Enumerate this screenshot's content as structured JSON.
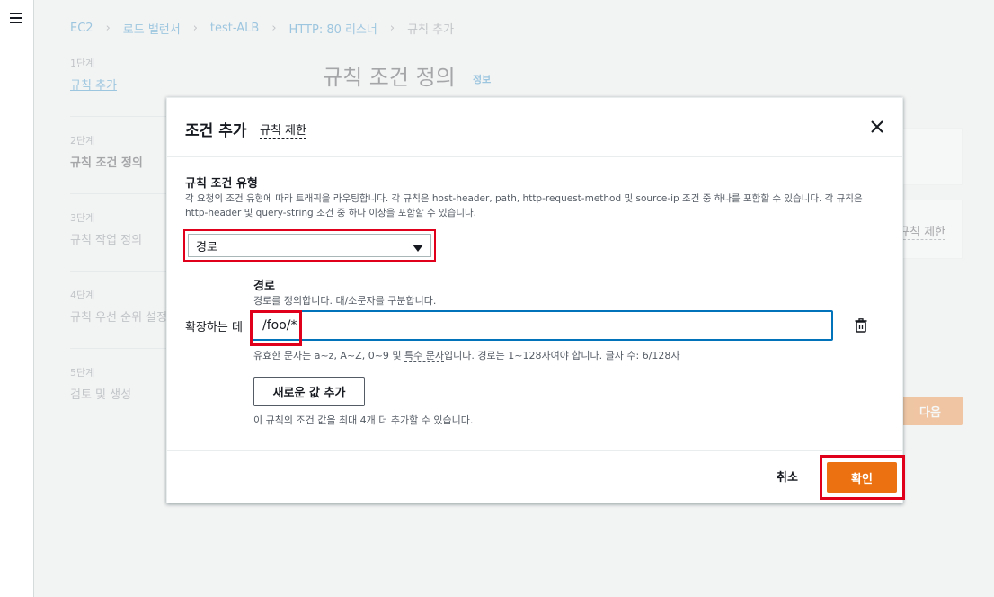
{
  "background": {
    "breadcrumb": [
      "EC2",
      "로드 밸런서",
      "test-ALB",
      "HTTP: 80 리스너",
      "규칙 추가"
    ],
    "steps": [
      {
        "num": "1단계",
        "label": "규칙 추가"
      },
      {
        "num": "2단계",
        "label": "규칙 조건 정의"
      },
      {
        "num": "3단계",
        "label": "규칙 작업 정의"
      },
      {
        "num": "4단계",
        "label": "규칙 우선 순위 설정"
      },
      {
        "num": "5단계",
        "label": "검토 및 생성"
      }
    ],
    "page_title": "규칙 조건 정의",
    "info_link": "정보",
    "rule_limit": "규칙 제한",
    "next_button": "다음"
  },
  "modal": {
    "title": "조건 추가",
    "subtitle_link": "규칙 제한",
    "field_label": "규칙 조건 유형",
    "field_desc": "각 요청의 조건 유형에 따라 트래픽을 라우팅합니다. 각 규칙은 host-header, path, http-request-method 및 source-ip 조건 중 하나를 포함할 수 있습니다. 각 규칙은 http-header 및 query-string 조건 중 하나 이상을 포함할 수 있습니다.",
    "select_value": "경로",
    "path_label": "경로",
    "path_desc": "경로를 정의합니다. 대/소문자를 구분합니다.",
    "row_label": "확장하는 데",
    "path_value": "/foo/*",
    "hint_prefix": "유효한 문자는 a~z, A~Z, 0~9 및 ",
    "hint_special": "특수 문자",
    "hint_suffix": "입니다. 경로는 1~128자여야 합니다. 글자 수: 6/128자",
    "add_value_button": "새로운 값 추가",
    "add_note": "이 규칙의 조건 값을 최대 4개 더 추가할 수 있습니다.",
    "cancel_button": "취소",
    "confirm_button": "확인"
  },
  "colors": {
    "accent": "#ec7211",
    "link": "#0073bb",
    "highlight": "#e0001b"
  }
}
